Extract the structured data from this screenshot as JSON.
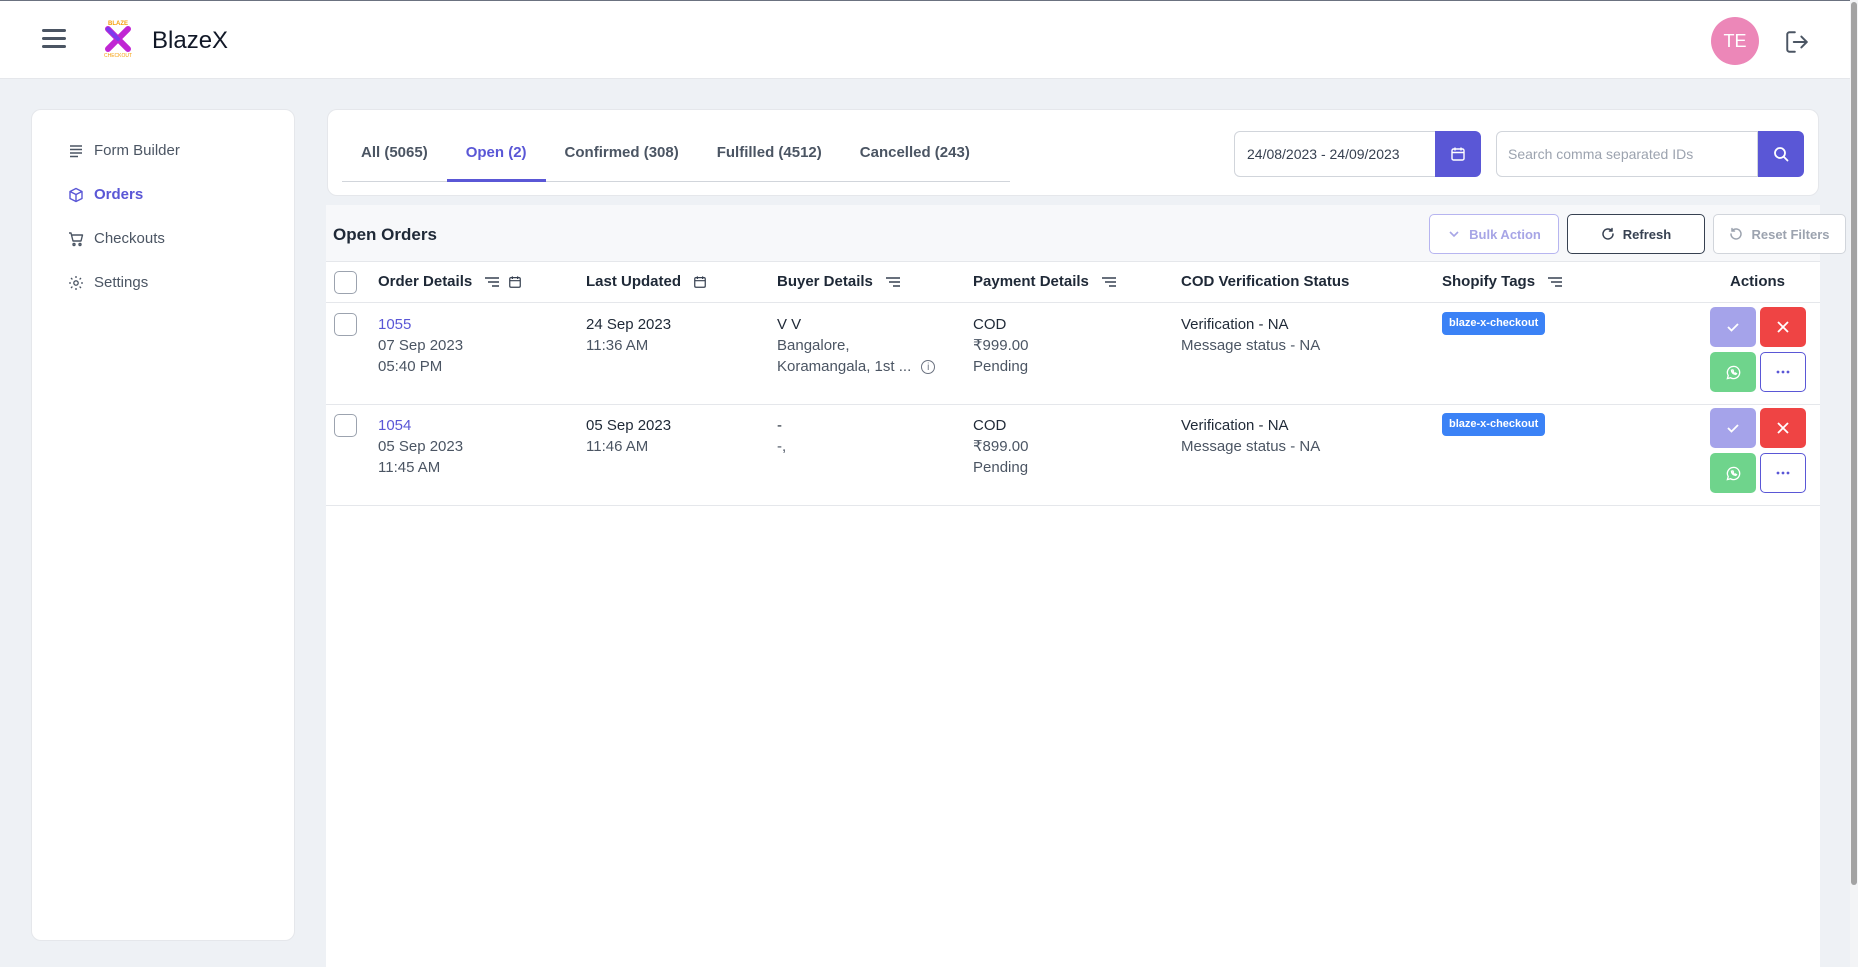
{
  "app": {
    "name": "BlazeX",
    "logo_text_top": "BLAZE",
    "logo_text_bottom": "CHECKOUT",
    "avatar_initials": "TE"
  },
  "sidebar": {
    "items": [
      {
        "label": "Form Builder",
        "icon": "form-lines-icon"
      },
      {
        "label": "Orders",
        "icon": "cube-icon",
        "active": true
      },
      {
        "label": "Checkouts",
        "icon": "cart-icon"
      },
      {
        "label": "Settings",
        "icon": "gear-icon"
      }
    ]
  },
  "tabs": [
    {
      "label": "All (5065)"
    },
    {
      "label": "Open (2)",
      "active": true
    },
    {
      "label": "Confirmed (308)"
    },
    {
      "label": "Fulfilled (4512)"
    },
    {
      "label": "Cancelled (243)"
    }
  ],
  "filters": {
    "date_range": "24/08/2023 - 24/09/2023",
    "search_placeholder": "Search comma separated IDs"
  },
  "panel": {
    "title": "Open Orders",
    "bulk_action": "Bulk Action",
    "refresh": "Refresh",
    "reset_filters": "Reset Filters"
  },
  "columns": {
    "order_details": "Order Details",
    "last_updated": "Last Updated",
    "buyer_details": "Buyer Details",
    "payment_details": "Payment Details",
    "cod_status": "COD Verification Status",
    "shopify_tags": "Shopify Tags",
    "actions": "Actions"
  },
  "orders": [
    {
      "id": "1055",
      "order_date": "07 Sep 2023",
      "order_time": "05:40 PM",
      "updated_date": "24 Sep 2023",
      "updated_time": "11:36 AM",
      "buyer_name": "V V",
      "buyer_city": "Bangalore,",
      "buyer_address": "Koramangala, 1st ...",
      "payment_method": "COD",
      "amount": "₹999.00",
      "payment_status": "Pending",
      "verification": "Verification - NA",
      "message_status": "Message status - NA",
      "tag": "blaze-x-checkout"
    },
    {
      "id": "1054",
      "order_date": "05 Sep 2023",
      "order_time": "11:45 AM",
      "updated_date": "05 Sep 2023",
      "updated_time": "11:46 AM",
      "buyer_name": "-",
      "buyer_city": "-,",
      "buyer_address": "",
      "payment_method": "COD",
      "amount": "₹899.00",
      "payment_status": "Pending",
      "verification": "Verification - NA",
      "message_status": "Message status - NA",
      "tag": "blaze-x-checkout"
    }
  ],
  "colors": {
    "accent": "#5a57d6",
    "danger": "#ef4444",
    "success": "#6fd48c",
    "tag": "#3b82f6",
    "avatar": "#ec87b8"
  }
}
